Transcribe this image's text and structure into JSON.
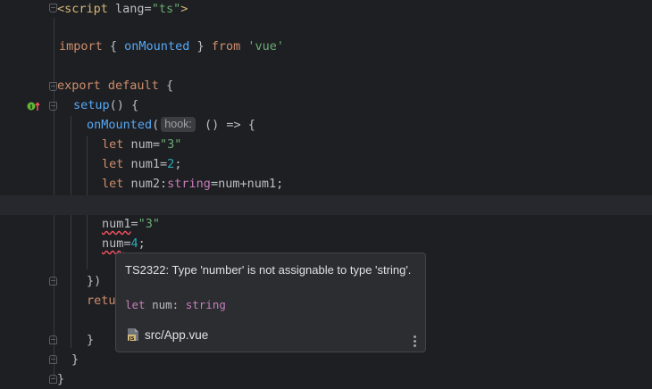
{
  "editor": {
    "lines": [
      {
        "id": "l1",
        "tokens": [
          [
            "tag",
            "<script"
          ],
          [
            "attr",
            " lang="
          ],
          [
            "str",
            "\"ts\""
          ],
          [
            "tag",
            ">"
          ]
        ]
      },
      {
        "id": "l2",
        "tokens": []
      },
      {
        "id": "l3",
        "tokens": [
          [
            "kw",
            "import"
          ],
          [
            "plain",
            " { "
          ],
          [
            "fn",
            "onMounted"
          ],
          [
            "plain",
            " } "
          ],
          [
            "kw",
            "from"
          ],
          [
            "plain",
            " "
          ],
          [
            "str",
            "'vue'"
          ]
        ]
      },
      {
        "id": "l4",
        "tokens": []
      },
      {
        "id": "l5",
        "tokens": [
          [
            "kw",
            "export"
          ],
          [
            "plain",
            " "
          ],
          [
            "kw",
            "default"
          ],
          [
            "plain",
            " {"
          ]
        ]
      },
      {
        "id": "l6",
        "tokens": [
          [
            "fn",
            "setup"
          ],
          [
            "plain",
            "() {"
          ]
        ]
      },
      {
        "id": "l7",
        "tokens": [
          [
            "fn",
            "onMounted"
          ],
          [
            "plain",
            "("
          ]
        ],
        "hint": "hook:",
        "after_hint": " () => {"
      },
      {
        "id": "l8",
        "tokens": [
          [
            "kw",
            "let"
          ],
          [
            "plain",
            " num="
          ],
          [
            "str",
            "\"3\""
          ]
        ]
      },
      {
        "id": "l9",
        "tokens": [
          [
            "kw",
            "let"
          ],
          [
            "plain",
            " num1="
          ],
          [
            "num",
            "2"
          ],
          [
            "plain",
            ";"
          ]
        ]
      },
      {
        "id": "l10",
        "tokens": [
          [
            "kw",
            "let"
          ],
          [
            "plain",
            " num2:"
          ],
          [
            "purple",
            "string"
          ],
          [
            "plain",
            "=num+num1;"
          ]
        ]
      },
      {
        "id": "l11",
        "tokens": []
      },
      {
        "id": "l12",
        "tokens": [
          [
            "err",
            "num1"
          ],
          [
            "plain",
            "="
          ],
          [
            "str",
            "\"3\""
          ]
        ]
      },
      {
        "id": "l13",
        "tokens": [
          [
            "err",
            "num"
          ],
          [
            "plain",
            "="
          ],
          [
            "num",
            "4"
          ],
          [
            "plain",
            ";"
          ]
        ]
      },
      {
        "id": "l14",
        "tokens": []
      },
      {
        "id": "l15",
        "tokens": [
          [
            "plain",
            "})"
          ]
        ]
      },
      {
        "id": "l16",
        "tokens": [
          [
            "kw",
            "retu"
          ]
        ]
      },
      {
        "id": "l17",
        "tokens": []
      },
      {
        "id": "l18",
        "tokens": [
          [
            "plain",
            "}"
          ]
        ]
      },
      {
        "id": "l19",
        "tokens": [
          [
            "plain",
            "}"
          ]
        ]
      },
      {
        "id": "l20",
        "tokens": [
          [
            "plain",
            "}"
          ]
        ]
      }
    ]
  },
  "tooltip": {
    "message": "TS2322: Type 'number' is not assignable to type 'string'.",
    "decl_keyword": "let",
    "decl_name": " num: ",
    "decl_type": "string",
    "file": "src/App.vue",
    "file_icon_label": "JS",
    "more_icon": "more-vertical-icon"
  },
  "colors": {
    "background": "#1e1f22",
    "error_underline": "#f75464",
    "keyword": "#cf8e6d",
    "string": "#6aab73",
    "function": "#56a8f5"
  },
  "gutter": {
    "icon": "implements-override-icon"
  }
}
